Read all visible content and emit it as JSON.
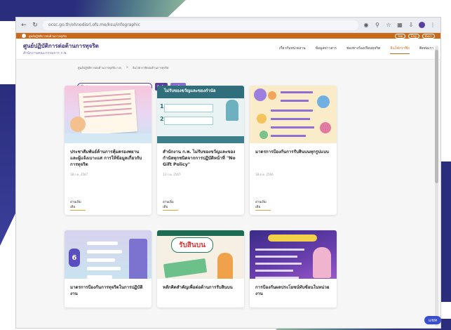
{
  "browser": {
    "url": "ocsc.go.th/ohnodisrl.ofs.me/ksu/infographic",
    "nav_icons": [
      "back-icon",
      "reload-icon"
    ],
    "tool_icons": [
      "translate-icon",
      "zoom-icon",
      "star-icon",
      "extensions-icon",
      "download-icon"
    ]
  },
  "topstrip": {
    "text": "ศูนย์ปฏิบัติการต่อต้านการทุจริต",
    "pill_1": "ไทย",
    "pill_2": "Eng",
    "pill_3": "ค้นหา"
  },
  "header": {
    "brand_title": "ศูนย์ปฏิบัติการต่อต้านการทุจริต",
    "brand_sub": "สำนักงานคณะกรรมการ ก.พ.",
    "menu": [
      {
        "label": "เกี่ยวกับหน่วยงาน"
      },
      {
        "label": "ข้อมูลข่าวสาร"
      },
      {
        "label": "ช่องทางร้องเรียนทุจริต"
      },
      {
        "label": "อินโฟกราฟิก"
      },
      {
        "label": "ติดต่อเรา"
      }
    ]
  },
  "breadcrumb": {
    "home": "ศูนย์ปฏิบัติการต่อต้านการทุจริต ก.พ.",
    "sep": ">",
    "current": "อินโฟกราฟิกต่อต้านการทุจริต"
  },
  "search": {
    "placeholder": "ค้นหา",
    "search_label": "ค้น",
    "clear_label": "ล้าง"
  },
  "cards": [
    {
      "title": "ประชาสัมพันธ์ด้านการคุ้มครองพยานและผู้แจ้งเบาะแส การให้ข้อมูลเกี่ยวกับการทุจริต",
      "date": "18 ก.ย. 2567",
      "more": "อ่านเพิ่มเติม"
    },
    {
      "title": "สำนักงาน ก.พ. ไม่รับของขวัญและของกำนัลทุกชนิดจากการปฏิบัติหน้าที่ \"No Gift Policy\"",
      "date": "13 ก.ค. 2567",
      "more": "อ่านเพิ่มเติม"
    },
    {
      "title": "มาตรการป้องกันการรับสินบนทุกรูปแบบ",
      "date": "18 ต.ค. 2566",
      "more": "อ่านเพิ่มเติม"
    },
    {
      "title": "มาตรการป้องกันการทุจริตในการปฏิบัติงาน",
      "date": "",
      "more": ""
    },
    {
      "title": "หลักคิดสำคัญเพื่อต่อต้านการรับสินบน",
      "date": "",
      "more": ""
    },
    {
      "title": "การป้องกันผลประโยชน์ทับซ้อนในหน่วยงาน",
      "date": "",
      "more": ""
    }
  ],
  "thumb_text": {
    "t2_head": "ไม่รับของขวัญและของกำนัล",
    "t2_n1": "1",
    "t2_n2": "2",
    "t4_num": "6",
    "t5_badge": "รับสินบน"
  },
  "fab": {
    "label": "แชท"
  }
}
